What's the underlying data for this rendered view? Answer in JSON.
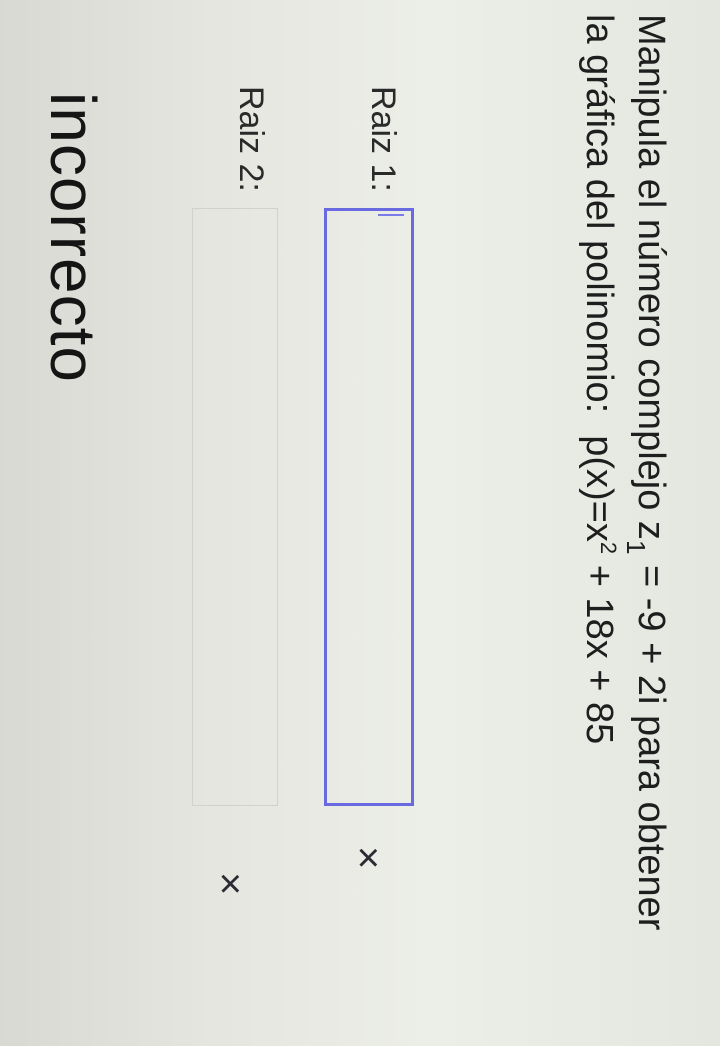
{
  "question": {
    "line1_prefix": "Manipula el número complejo z",
    "z_subscript": "1",
    "z_value": "= -9 + 2i para obtener",
    "line2_prefix": "la gráfica del polinomio:",
    "poly_base": "p(x)=x",
    "poly_exponent": "2",
    "poly_rest": "+ 18x + 85"
  },
  "answers": {
    "root1": {
      "label": "Raiz 1:",
      "value": ""
    },
    "root2": {
      "label": "Raiz 2:",
      "value": ""
    }
  },
  "status_marks": {
    "root1": "×",
    "root2": "×"
  },
  "feedback": "incorrecto"
}
